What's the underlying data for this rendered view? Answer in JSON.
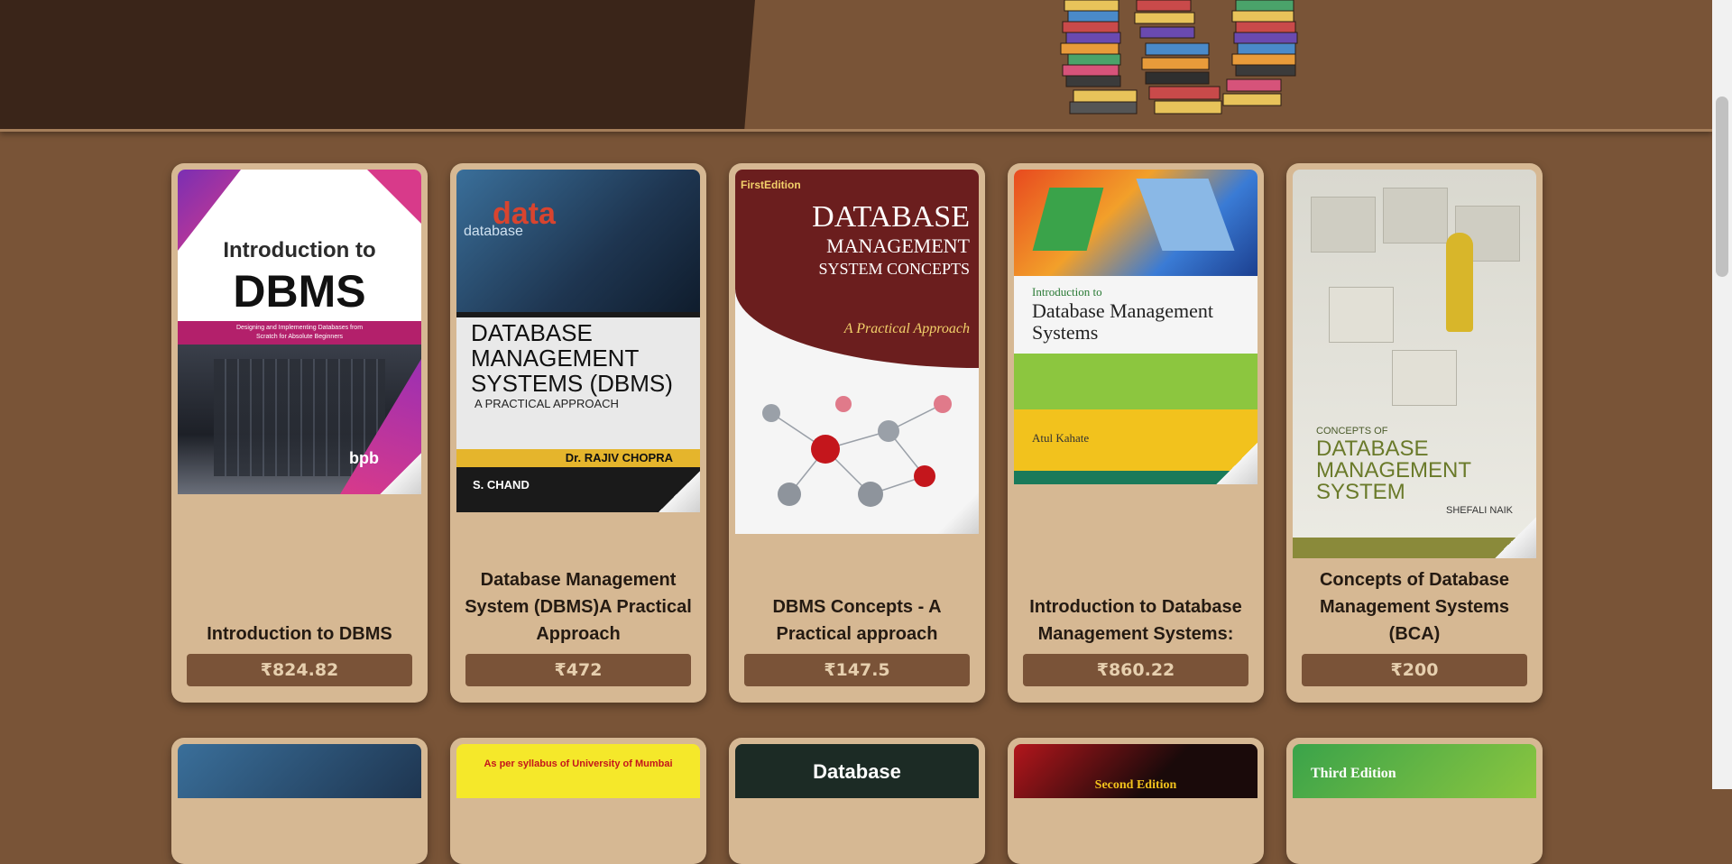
{
  "books": [
    {
      "title": "Introduction to DBMS",
      "price": "₹824.82",
      "cover_lines": [
        "Introduction to",
        "DBMS",
        "Designing and Implementing Databases from",
        "Scratch for Absolute Beginners",
        "bpb"
      ]
    },
    {
      "title": "Database Management System (DBMS)A Practical Approach",
      "price": "₹472",
      "cover_lines": [
        "data",
        "database",
        "DATABASE",
        "MANAGEMENT",
        "SYSTEMS (DBMS)",
        "A PRACTICAL APPROACH",
        "Dr. RAJIV CHOPRA",
        "S. CHAND"
      ]
    },
    {
      "title": "DBMS Concepts - A Practical approach",
      "price": "₹147.5",
      "cover_lines": [
        "FirstEdition",
        "DATABASE",
        "MANAGEMENT",
        "SYSTEM CONCEPTS",
        "A Practical Approach"
      ]
    },
    {
      "title": "Introduction to Database Management Systems:",
      "price": "₹860.22",
      "cover_lines": [
        "Introduction to",
        "Database Management",
        "Systems",
        "Atul Kahate"
      ]
    },
    {
      "title": "Concepts of Database Management Systems (BCA)",
      "price": "₹200",
      "cover_lines": [
        "CONCEPTS OF",
        "DATABASE",
        "MANAGEMENT",
        "SYSTEM",
        "SHEFALI NAIK"
      ]
    }
  ],
  "row2_covers": [
    {
      "label": ""
    },
    {
      "label": "As per syllabus of University of Mumbai"
    },
    {
      "label": "Database"
    },
    {
      "label": "Second Edition"
    },
    {
      "label": "Third Edition"
    }
  ]
}
